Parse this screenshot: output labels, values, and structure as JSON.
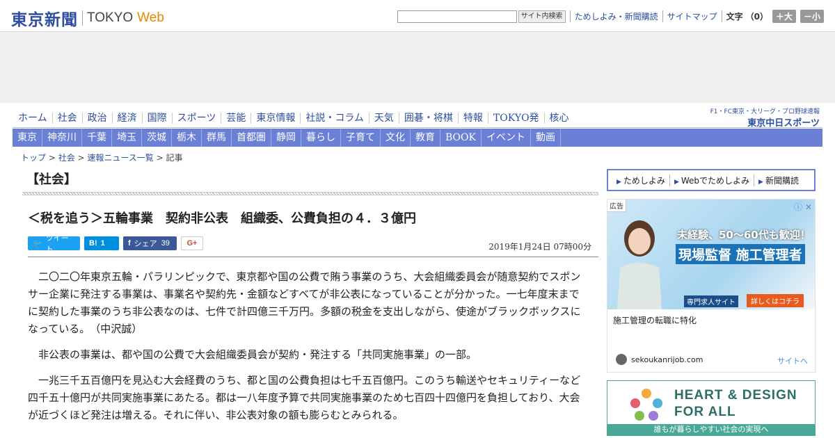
{
  "header": {
    "logo_jp": "東京新聞",
    "logo_en": "TOKYO",
    "logo_web": "Web",
    "search_button": "サイト内検索",
    "links": [
      "ためしよみ・新聞購読",
      "サイトマップ"
    ],
    "font_label": "文字",
    "font_count": "（0）",
    "font_up": "＋大",
    "font_down": "－小"
  },
  "nav_primary": [
    "ホーム",
    "社会",
    "政治",
    "経済",
    "国際",
    "スポーツ",
    "芸能",
    "東京情報",
    "社説・コラム",
    "天気",
    "囲碁・将棋",
    "特報",
    "TOKYO発",
    "核心"
  ],
  "chuspo": {
    "line1": "F1・FC東京・大リーグ・プロ野球速報",
    "line2": "東京中日スポーツ"
  },
  "nav_regional": [
    "東京",
    "神奈川",
    "千葉",
    "埼玉",
    "茨城",
    "栃木",
    "群馬",
    "首都圏",
    "静岡",
    "暮らし",
    "子育て",
    "文化",
    "教育",
    "BOOK",
    "イベント",
    "動画"
  ],
  "breadcrumb": {
    "top": "トップ",
    "section": "社会",
    "list": "速報ニュース一覧",
    "current": "記事",
    "sep": " > "
  },
  "article": {
    "section": "【社会】",
    "headline": "＜税を追う＞五輪事業　契約非公表　組織委、公費負担の４．３億円",
    "date": "2019年1月24日 07時00分",
    "share": {
      "tweet": "ツイート",
      "hatena_count": "1",
      "facebook": "シェア",
      "facebook_count": "39",
      "gplus": "G+"
    },
    "paragraphs": [
      "二〇二〇年東京五輪・パラリンピックで、東京都や国の公費で賄う事業のうち、大会組織委員会が随意契約でスポンサー企業に発注する事業は、事業名や契約先・金額などすべてが非公表になっていることが分かった。一七年度末までに契約した事業のうち非公表なのは、七件で計四億三千万円。多額の税金を支出しながら、使途がブラックボックスになっている。　（中沢誠）",
      "非公表の事業は、都や国の公費で大会組織委員会が契約・発注する「共同実施事業」の一部。",
      "一兆三千五百億円を見込む大会経費のうち、都と国の公費負担は七千五百億円。このうち輸送やセキュリティーなど四千五十億円が共同実施事業にあたる。都は一八年度予算で共同実施事業のため七百四十四億円を負担しており、大会が近づくほど発注は増える。それに伴い、非公表対象の額も膨らむとみられる。"
    ]
  },
  "sidebar": {
    "links": [
      "ためしよみ",
      "Webでためしよみ",
      "新聞購読"
    ],
    "ad1": {
      "tag": "広告",
      "close": "ⓘ ✕",
      "line1": "未経験、50〜60代も歓迎！",
      "line2": "現場監督 施工管理者",
      "badge": "専門求人サイト",
      "cta": "詳しくはコチラ",
      "caption": "施工管理の転職に特化",
      "domain": "sekoukanrijob.com",
      "site_link": "サイトへ"
    },
    "ad2": {
      "title1": "HEART & DESIGN",
      "title2": "FOR ALL",
      "bar": "誰もが暮らしやすい社会の実現へ"
    }
  },
  "colors": {
    "brand": "#2c4da1",
    "nav_bg": "#6a7fd6",
    "accent": "#e38b00"
  }
}
